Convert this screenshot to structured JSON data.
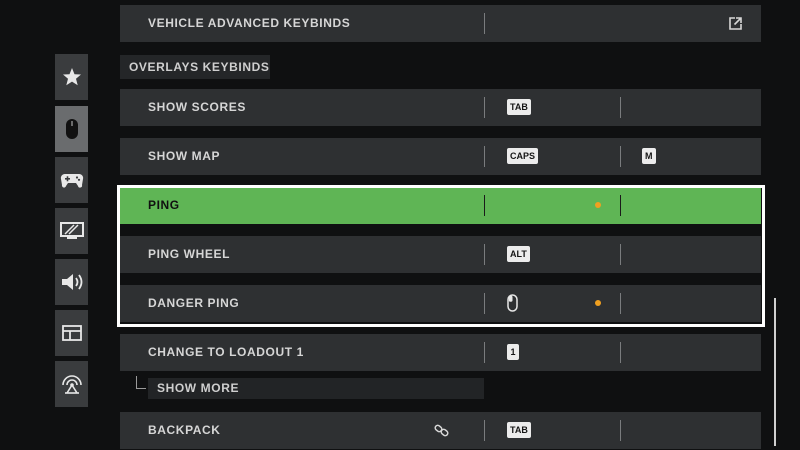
{
  "sidebar": {
    "tabs": [
      {
        "icon": "star-icon",
        "active": false
      },
      {
        "icon": "mouse-icon",
        "active": true
      },
      {
        "icon": "gamepad-icon",
        "active": false
      },
      {
        "icon": "display-icon",
        "active": false
      },
      {
        "icon": "speaker-icon",
        "active": false
      },
      {
        "icon": "interface-icon",
        "active": false
      },
      {
        "icon": "network-icon",
        "active": false
      }
    ]
  },
  "rows": {
    "vehicle_advanced": {
      "label": "VEHICLE ADVANCED KEYBINDS",
      "icon": "external-link-icon"
    },
    "show_scores": {
      "label": "SHOW SCORES",
      "primary": "TAB",
      "alternate": ""
    },
    "show_map": {
      "label": "SHOW MAP",
      "primary": "CAPS",
      "alternate": "M"
    },
    "ping": {
      "label": "PING",
      "primary": "",
      "alternate": "",
      "unsaved": true
    },
    "ping_wheel": {
      "label": "PING WHEEL",
      "primary": "ALT",
      "alternate": ""
    },
    "danger_ping": {
      "label": "DANGER PING",
      "primary_icon": "mouse-button-icon",
      "alternate": "",
      "unsaved": true
    },
    "change_loadout": {
      "label": "CHANGE TO LOADOUT 1",
      "primary": "1",
      "alternate": ""
    },
    "backpack": {
      "label": "BACKPACK",
      "primary": "TAB",
      "alternate": "",
      "icon": "link-icon"
    }
  },
  "section": {
    "overlays_label": "OVERLAYS KEYBINDS"
  },
  "show_more": {
    "label": "SHOW MORE"
  },
  "colors": {
    "highlight": "#5fb555",
    "unsaved_dot": "#f0a020",
    "row_bg": "#2e3032"
  }
}
